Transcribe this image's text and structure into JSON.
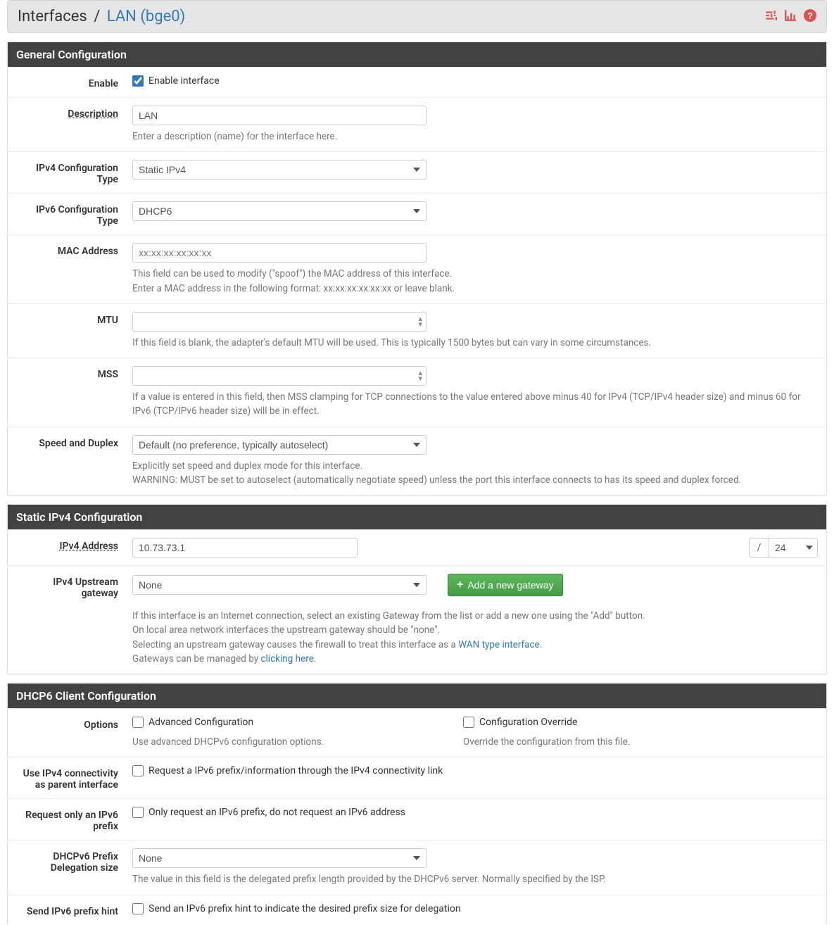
{
  "colors": {
    "accent": "#337ab7",
    "danger": "#d9534f",
    "success": "#5cb85c",
    "panel_header": "#424242"
  },
  "breadcrumb": {
    "root": "Interfaces",
    "sep": "/",
    "leaf": "LAN (bge0)"
  },
  "general": {
    "title": "General Configuration",
    "enable": {
      "label": "Enable",
      "cb_label": "Enable interface",
      "checked": true
    },
    "description": {
      "label": "Description",
      "value": "LAN",
      "help": "Enter a description (name) for the interface here."
    },
    "ipv4_type": {
      "label": "IPv4 Configuration Type",
      "value": "Static IPv4"
    },
    "ipv6_type": {
      "label": "IPv6 Configuration Type",
      "value": "DHCP6"
    },
    "mac": {
      "label": "MAC Address",
      "placeholder": "xx:xx:xx:xx:xx:xx",
      "help1": "This field can be used to modify (\"spoof\") the MAC address of this interface.",
      "help2": "Enter a MAC address in the following format: xx:xx:xx:xx:xx:xx or leave blank."
    },
    "mtu": {
      "label": "MTU",
      "help": "If this field is blank, the adapter's default MTU will be used. This is typically 1500 bytes but can vary in some circumstances."
    },
    "mss": {
      "label": "MSS",
      "help": "If a value is entered in this field, then MSS clamping for TCP connections to the value entered above minus 40 for IPv4 (TCP/IPv4 header size) and minus 60 for IPv6 (TCP/IPv6 header size) will be in effect."
    },
    "speed": {
      "label": "Speed and Duplex",
      "value": "Default (no preference, typically autoselect)",
      "help1": "Explicitly set speed and duplex mode for this interface.",
      "help2": "WARNING: MUST be set to autoselect (automatically negotiate speed) unless the port this interface connects to has its speed and duplex forced."
    }
  },
  "static_ipv4": {
    "title": "Static IPv4 Configuration",
    "address": {
      "label": "IPv4 Address",
      "value": "10.73.73.1",
      "slash": "/",
      "cidr": "24"
    },
    "gateway": {
      "label": "IPv4 Upstream gateway",
      "value": "None",
      "button": "Add a new gateway",
      "help1": "If this interface is an Internet connection, select an existing Gateway from the list or add a new one using the \"Add\" button.",
      "help2": "On local area network interfaces the upstream gateway should be \"none\".",
      "help3_a": "Selecting an upstream gateway causes the firewall to treat this interface as a ",
      "help3_link": "WAN type interface",
      "help3_b": ".",
      "help4_a": "Gateways can be managed by ",
      "help4_link": "clicking here",
      "help4_b": "."
    }
  },
  "dhcp6": {
    "title": "DHCP6 Client Configuration",
    "options": {
      "label": "Options",
      "adv_label": "Advanced Configuration",
      "adv_help": "Use advanced DHCPv6 configuration options.",
      "ovr_label": "Configuration Override",
      "ovr_help": "Override the configuration from this file."
    },
    "ipv4_parent": {
      "label": "Use IPv4 connectivity as parent interface",
      "cb_label": "Request a IPv6 prefix/information through the IPv4 connectivity link"
    },
    "only_prefix": {
      "label": "Request only an IPv6 prefix",
      "cb_label": "Only request an IPv6 prefix, do not request an IPv6 address"
    },
    "pd_size": {
      "label": "DHCPv6 Prefix Delegation size",
      "value": "None",
      "help": "The value in this field is the delegated prefix length provided by the DHCPv6 server. Normally specified by the ISP."
    },
    "hint": {
      "label": "Send IPv6 prefix hint",
      "cb_label": "Send an IPv6 prefix hint to indicate the desired prefix size for delegation"
    }
  }
}
